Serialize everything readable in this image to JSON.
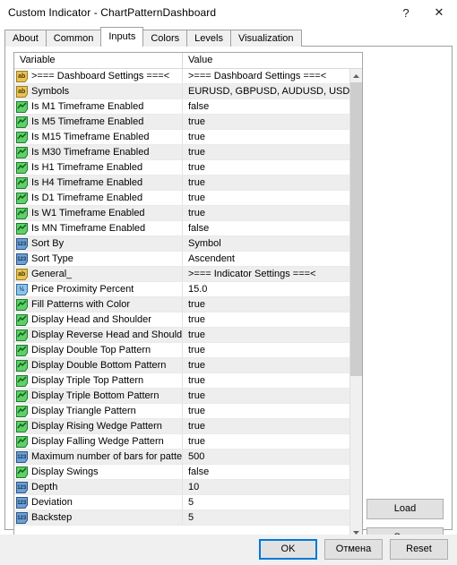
{
  "window": {
    "title": "Custom Indicator - ChartPatternDashboard",
    "help_label": "?",
    "close_label": "✕"
  },
  "tabs": [
    {
      "label": "About",
      "active": false
    },
    {
      "label": "Common",
      "active": false
    },
    {
      "label": "Inputs",
      "active": true
    },
    {
      "label": "Colors",
      "active": false
    },
    {
      "label": "Levels",
      "active": false
    },
    {
      "label": "Visualization",
      "active": false
    }
  ],
  "grid": {
    "columns": [
      "Variable",
      "Value"
    ],
    "rows": [
      {
        "icon": "ab-string-icon",
        "variable": ">=== Dashboard Settings ===<",
        "value": ">=== Dashboard Settings ===<"
      },
      {
        "icon": "ab-string-icon",
        "variable": "Symbols",
        "value": "EURUSD, GBPUSD, AUDUSD, USDCAD..."
      },
      {
        "icon": "bool-chart-icon",
        "variable": "Is M1 Timeframe Enabled",
        "value": "false"
      },
      {
        "icon": "bool-chart-icon",
        "variable": "Is M5 Timeframe Enabled",
        "value": "true"
      },
      {
        "icon": "bool-chart-icon",
        "variable": "Is M15 Timeframe Enabled",
        "value": "true"
      },
      {
        "icon": "bool-chart-icon",
        "variable": "Is M30 Timeframe Enabled",
        "value": "true"
      },
      {
        "icon": "bool-chart-icon",
        "variable": "Is H1 Timeframe Enabled",
        "value": "true"
      },
      {
        "icon": "bool-chart-icon",
        "variable": "Is H4 Timeframe Enabled",
        "value": "true"
      },
      {
        "icon": "bool-chart-icon",
        "variable": "Is D1 Timeframe Enabled",
        "value": "true"
      },
      {
        "icon": "bool-chart-icon",
        "variable": "Is W1 Timeframe Enabled",
        "value": "true"
      },
      {
        "icon": "bool-chart-icon",
        "variable": "Is MN Timeframe Enabled",
        "value": "false"
      },
      {
        "icon": "integer-123-icon",
        "variable": "Sort By",
        "value": "Symbol"
      },
      {
        "icon": "integer-123-icon",
        "variable": "Sort Type",
        "value": "Ascendent"
      },
      {
        "icon": "ab-string-icon",
        "variable": "General_",
        "value": ">=== Indicator Settings ===<"
      },
      {
        "icon": "double-half-icon",
        "variable": "Price Proximity Percent",
        "value": "15.0"
      },
      {
        "icon": "bool-chart-icon",
        "variable": "Fill Patterns with Color",
        "value": "true"
      },
      {
        "icon": "bool-chart-icon",
        "variable": "Display Head and Shoulder",
        "value": "true"
      },
      {
        "icon": "bool-chart-icon",
        "variable": "Display Reverse Head and Shoulder P...",
        "value": "true"
      },
      {
        "icon": "bool-chart-icon",
        "variable": "Display Double Top Pattern",
        "value": "true"
      },
      {
        "icon": "bool-chart-icon",
        "variable": "Display Double Bottom Pattern",
        "value": "true"
      },
      {
        "icon": "bool-chart-icon",
        "variable": "Display Triple Top Pattern",
        "value": "true"
      },
      {
        "icon": "bool-chart-icon",
        "variable": "Display Triple Bottom Pattern",
        "value": "true"
      },
      {
        "icon": "bool-chart-icon",
        "variable": "Display Triangle Pattern",
        "value": "true"
      },
      {
        "icon": "bool-chart-icon",
        "variable": "Display Rising Wedge Pattern",
        "value": "true"
      },
      {
        "icon": "bool-chart-icon",
        "variable": "Display Falling Wedge Pattern",
        "value": "true"
      },
      {
        "icon": "integer-123-icon",
        "variable": "Maximum number of bars for patterns s...",
        "value": "500"
      },
      {
        "icon": "bool-chart-icon",
        "variable": "Display Swings",
        "value": "false"
      },
      {
        "icon": "integer-123-icon",
        "variable": "Depth",
        "value": "10"
      },
      {
        "icon": "integer-123-icon",
        "variable": "Deviation",
        "value": "5"
      },
      {
        "icon": "integer-123-icon",
        "variable": "Backstep",
        "value": "5"
      }
    ]
  },
  "scrollbar": {
    "up_arrow": "▲",
    "down_arrow": "▼",
    "thumb_top_pct": 0,
    "thumb_height_pct": 66
  },
  "side_buttons": [
    {
      "label": "Load"
    },
    {
      "label": "Save"
    }
  ],
  "footer_buttons": [
    {
      "label": "OK",
      "default": true
    },
    {
      "label": "Отмена",
      "default": false
    },
    {
      "label": "Reset",
      "default": false
    }
  ],
  "colors": {
    "accent": "#0078d7",
    "row_alt": "#eeeeee",
    "border": "#a0a0a0",
    "icon_string": "#e8c255",
    "icon_bool": "#4caf50",
    "icon_int": "#4a80c0"
  }
}
